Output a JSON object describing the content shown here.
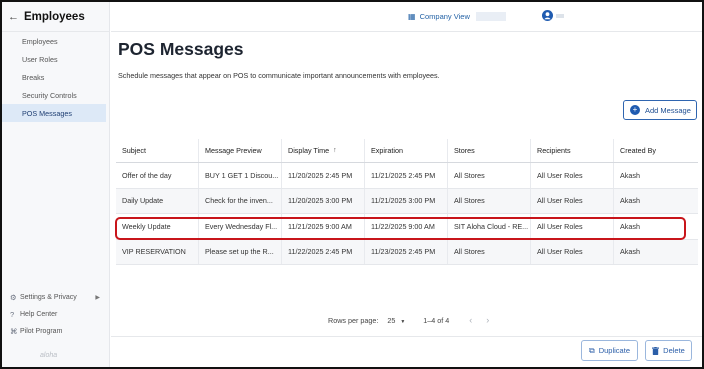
{
  "sidebar": {
    "title": "Employees",
    "items": [
      {
        "label": "Employees"
      },
      {
        "label": "User Roles"
      },
      {
        "label": "Breaks"
      },
      {
        "label": "Security Controls"
      },
      {
        "label": "POS Messages"
      }
    ],
    "footer": [
      {
        "label": "Settings & Privacy"
      },
      {
        "label": "Help Center"
      },
      {
        "label": "Pilot Program"
      }
    ],
    "logo": "aloha"
  },
  "topbar": {
    "company_label": "Company View"
  },
  "page": {
    "title": "POS Messages",
    "subtitle": "Schedule messages that appear on POS to communicate important announcements with employees.",
    "add_button": "Add Message"
  },
  "table": {
    "columns": [
      "Subject",
      "Message Preview",
      "Display Time",
      "Expiration",
      "Stores",
      "Recipients",
      "Created By"
    ],
    "rows": [
      [
        "Offer of the day",
        "BUY 1 GET 1 Discou...",
        "11/20/2025 2:45 PM",
        "11/21/2025 2:45 PM",
        "All Stores",
        "All User Roles",
        "Akash"
      ],
      [
        "Daily Update",
        "Check for the inven...",
        "11/20/2025 3:00 PM",
        "11/21/2025 3:00 PM",
        "All Stores",
        "All User Roles",
        "Akash"
      ],
      [
        "Weekly Update",
        "Every Wednesday Fl...",
        "11/21/2025 9:00 AM",
        "11/22/2025 9:00 AM",
        "SIT Aloha Cloud - RE...",
        "All User Roles",
        "Akash"
      ],
      [
        "VIP RESERVATION",
        "Please set up the R...",
        "11/22/2025 2:45 PM",
        "11/23/2025 2:45 PM",
        "All Stores",
        "All User Roles",
        "Akash"
      ]
    ]
  },
  "pagination": {
    "rows_per_page_label": "Rows per page:",
    "rows_per_page_value": "25",
    "range": "1–4 of 4"
  },
  "actions": {
    "duplicate": "Duplicate",
    "delete": "Delete"
  },
  "colors": {
    "accent": "#1f5bb0",
    "highlight": "#c8151b",
    "active_nav": "#dde9f7"
  }
}
